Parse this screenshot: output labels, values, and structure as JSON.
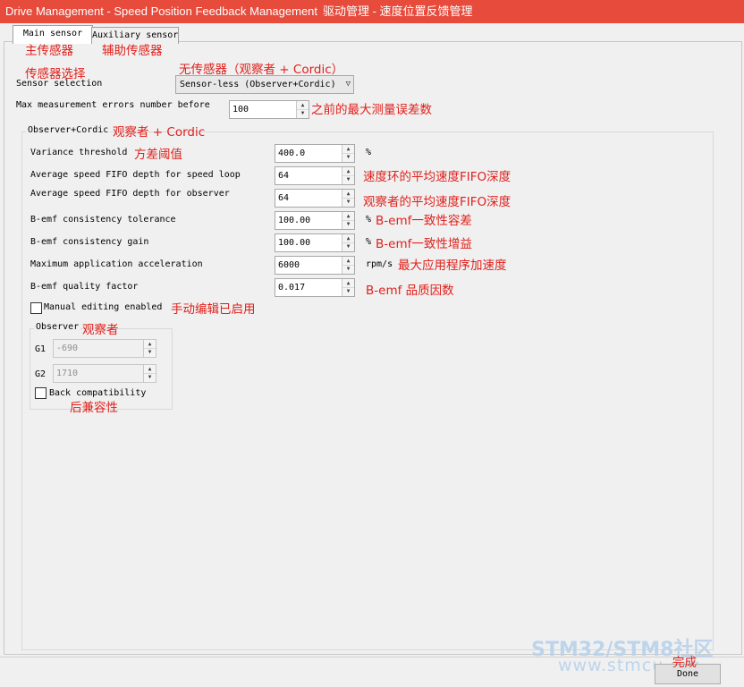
{
  "window": {
    "title": "Drive Management - Speed Position Feedback Management",
    "title_cn": "驱动管理 - 速度位置反馈管理"
  },
  "tabs": [
    {
      "label": "Main sensor",
      "annotation": "主传感器"
    },
    {
      "label": "Auxiliary sensor",
      "annotation": "辅助传感器"
    }
  ],
  "sensor": {
    "label": "Sensor selection",
    "annotation": "传感器选择",
    "selected": "Sensor-less (Observer+Cordic)",
    "selected_annotation": "无传感器（观察者 + Cordic）"
  },
  "max_errors": {
    "label": "Max measurement errors number before",
    "value": "100",
    "annotation": "之前的最大测量误差数"
  },
  "observer_cordic_group": {
    "title": "Observer+Cordic",
    "annotation": "观察者 + Cordic",
    "fields": [
      {
        "label": "Variance threshold",
        "label_annotation": "方差阈值",
        "value": "400.0",
        "unit": "%",
        "annotation": ""
      },
      {
        "label": "Average speed FIFO depth for speed loop",
        "label_annotation": "",
        "value": "64",
        "unit": "",
        "annotation": "速度环的平均速度FIFO深度"
      },
      {
        "label": "Average speed FIFO depth for observer",
        "label_annotation": "",
        "value": "64",
        "unit": "",
        "annotation": "观察者的平均速度FIFO深度"
      },
      {
        "label": "B-emf consistency tolerance",
        "label_annotation": "",
        "value": "100.00",
        "unit": "%",
        "annotation": "B-emf一致性容差"
      },
      {
        "label": "B-emf consistency gain",
        "label_annotation": "",
        "value": "100.00",
        "unit": "%",
        "annotation": "B-emf一致性增益"
      },
      {
        "label": "Maximum application acceleration",
        "label_annotation": "",
        "value": "6000",
        "unit": "rpm/s",
        "annotation": "最大应用程序加速度"
      },
      {
        "label": "B-emf quality factor",
        "label_annotation": "",
        "value": "0.017",
        "unit": "",
        "annotation": "B-emf 品质因数"
      }
    ],
    "manual_editing": {
      "label": "Manual editing enabled",
      "checked": false,
      "annotation": "手动编辑已启用"
    }
  },
  "observer_group": {
    "title": "Observer",
    "annotation": "观察者",
    "g1": {
      "label": "G1",
      "value": "-690"
    },
    "g2": {
      "label": "G2",
      "value": "1710"
    },
    "back_compat": {
      "label": "Back compatibility",
      "checked": false,
      "annotation": "后兼容性"
    }
  },
  "footer": {
    "done_label": "Done",
    "done_annotation": "完成"
  },
  "watermark": {
    "line1": "STM32/STM8社区",
    "line2": "www.stmcu.org"
  },
  "colors": {
    "titlebar": "#e64b3c",
    "annotation": "#e0201b",
    "watermark": "#b7d2ec"
  }
}
